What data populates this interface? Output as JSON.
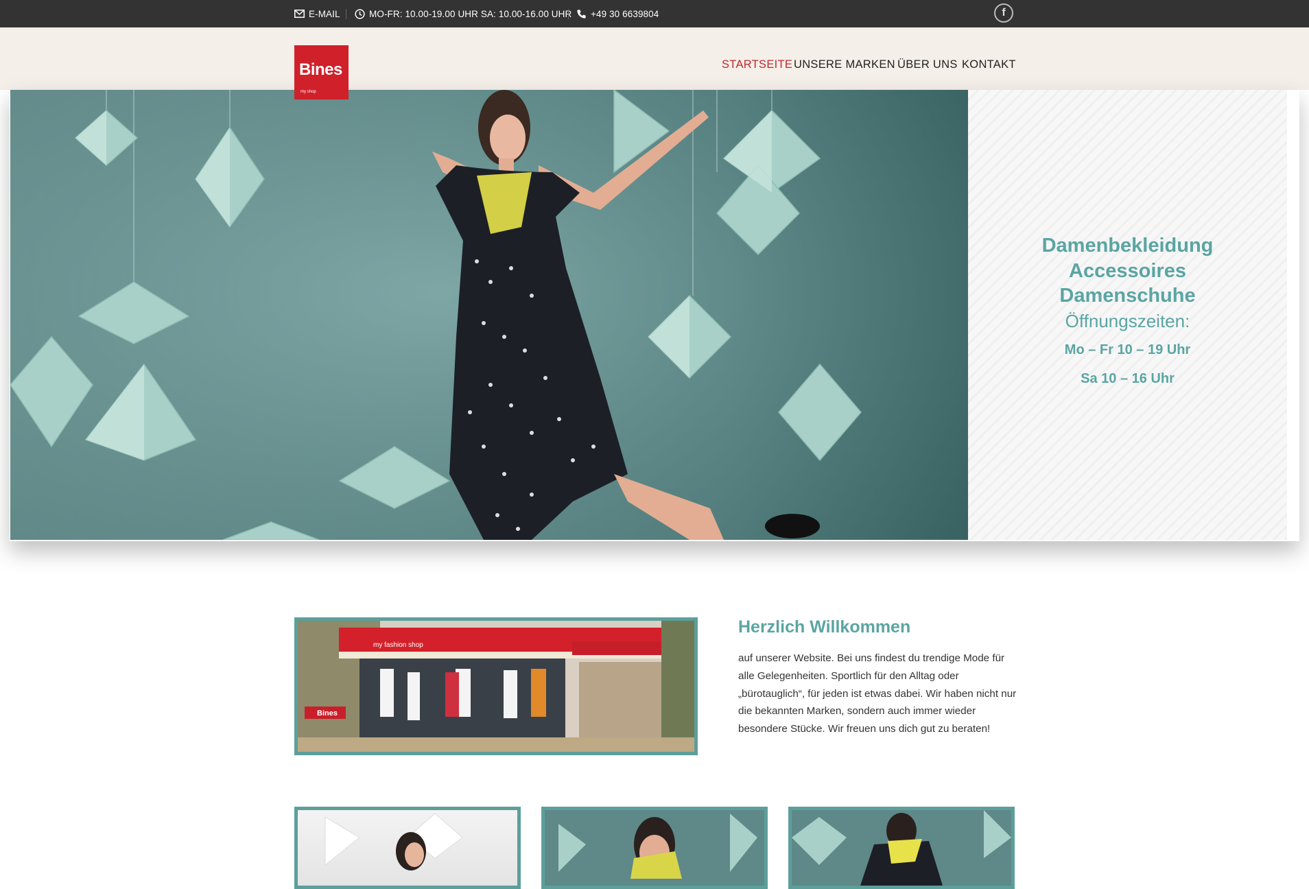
{
  "topbar": {
    "email_label": "E-MAIL",
    "hours_label": "MO-FR: 10.00-19.00 UHR SA: 10.00-16.00 UHR",
    "phone_label": "+49 30 6639804",
    "facebook_icon": "facebook-icon"
  },
  "brand": {
    "name": "Bines",
    "tagline": "my shop",
    "color": "#d0202a"
  },
  "nav": {
    "items": [
      {
        "label": "STARTSEITE",
        "active": true
      },
      {
        "label": "UNSERE MARKEN",
        "active": false
      },
      {
        "label": "ÜBER UNS",
        "active": false
      },
      {
        "label": "KONTAKT",
        "active": false
      }
    ],
    "active_color": "#c0282d"
  },
  "hero": {
    "line1": "Damenbekleidung",
    "line2": "Accessoires",
    "line3": "Damenschuhe",
    "hours_title": "Öffnungszeiten:",
    "hours_weekday": "Mo – Fr 10 – 19 Uhr",
    "hours_saturday": "Sa 10 – 16 Uhr",
    "accent_color": "#5aa5a3"
  },
  "welcome": {
    "title": "Herzlich Willkommen",
    "text": "auf unserer Website. Bei uns findest du trendige Mode für alle Gelegenheiten. Sportlich für den Alltag oder „bürotauglich“, für jeden ist etwas dabei. Wir haben nicht nur die bekannten Marken, sondern auch immer wieder besondere Stücke. Wir freuen uns dich gut zu beraten!",
    "store_sign": "my fashion shop",
    "store_logo": "Bines"
  }
}
